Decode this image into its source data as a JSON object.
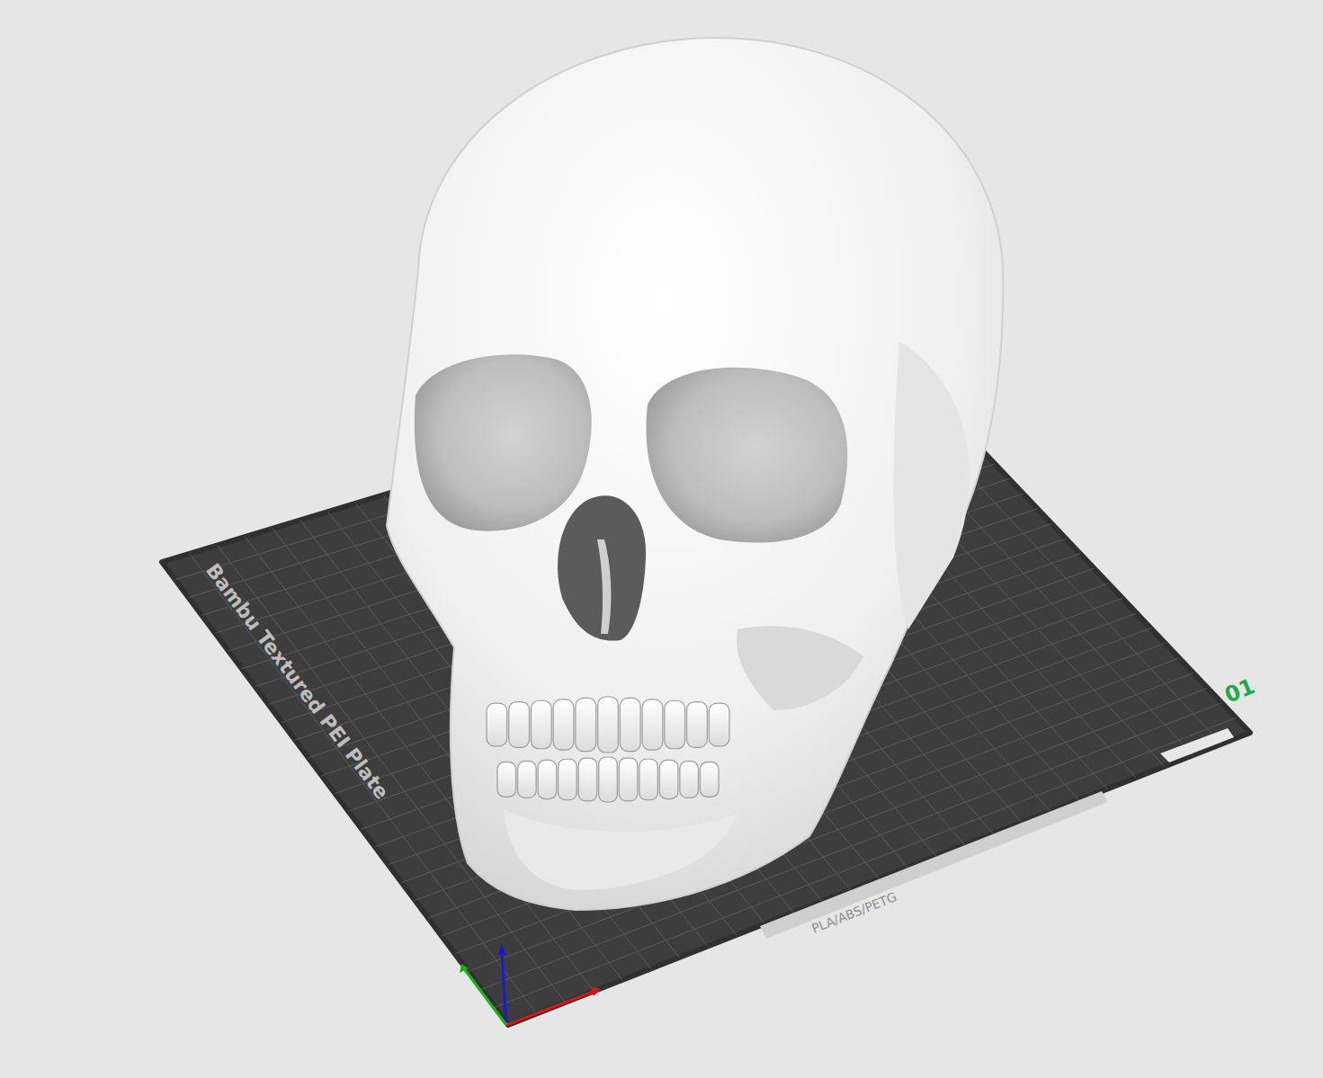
{
  "viewport": {
    "plate": {
      "label": "Bambu Textured PEI Plate",
      "number": "01",
      "materials": "PLA/ABS/PETG"
    }
  }
}
